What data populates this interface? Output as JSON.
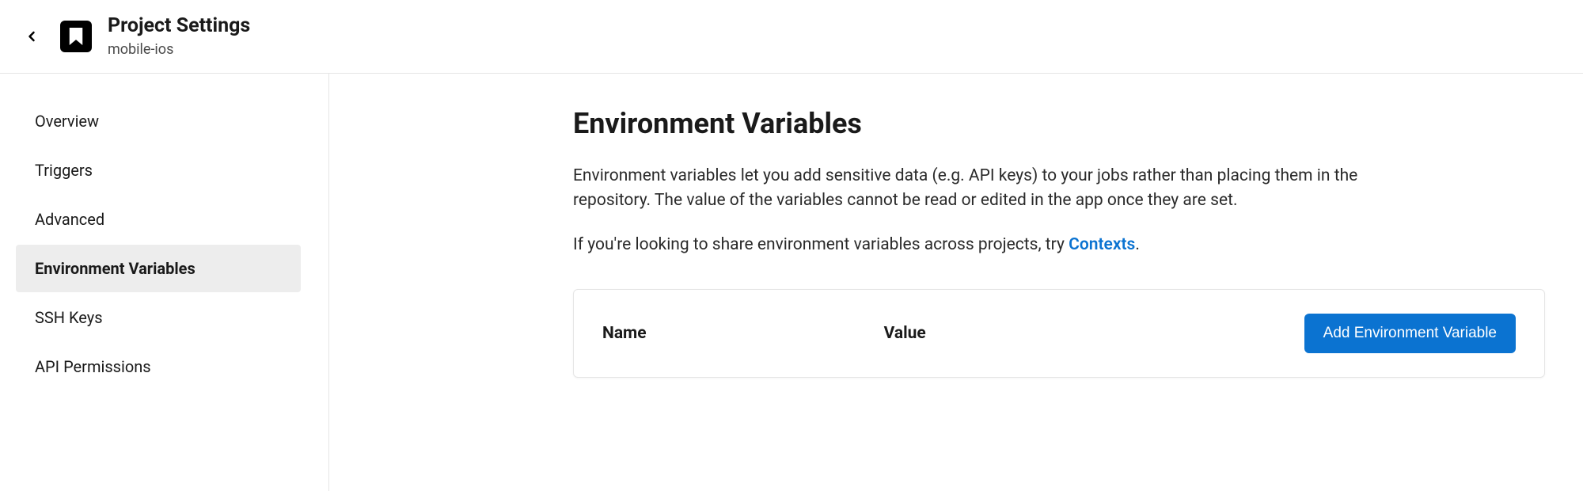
{
  "header": {
    "title": "Project Settings",
    "subtitle": "mobile-ios"
  },
  "sidebar": {
    "items": [
      {
        "label": "Overview",
        "active": false
      },
      {
        "label": "Triggers",
        "active": false
      },
      {
        "label": "Advanced",
        "active": false
      },
      {
        "label": "Environment Variables",
        "active": true
      },
      {
        "label": "SSH Keys",
        "active": false
      },
      {
        "label": "API Permissions",
        "active": false
      }
    ]
  },
  "main": {
    "title": "Environment Variables",
    "description": "Environment variables let you add sensitive data (e.g. API keys) to your jobs rather than placing them in the repository. The value of the variables cannot be read or edited in the app once they are set.",
    "contexts_prefix": "If you're looking to share environment variables across projects, try ",
    "contexts_link": "Contexts",
    "contexts_suffix": ".",
    "table": {
      "columns": {
        "name": "Name",
        "value": "Value"
      },
      "add_button": "Add Environment Variable"
    }
  }
}
